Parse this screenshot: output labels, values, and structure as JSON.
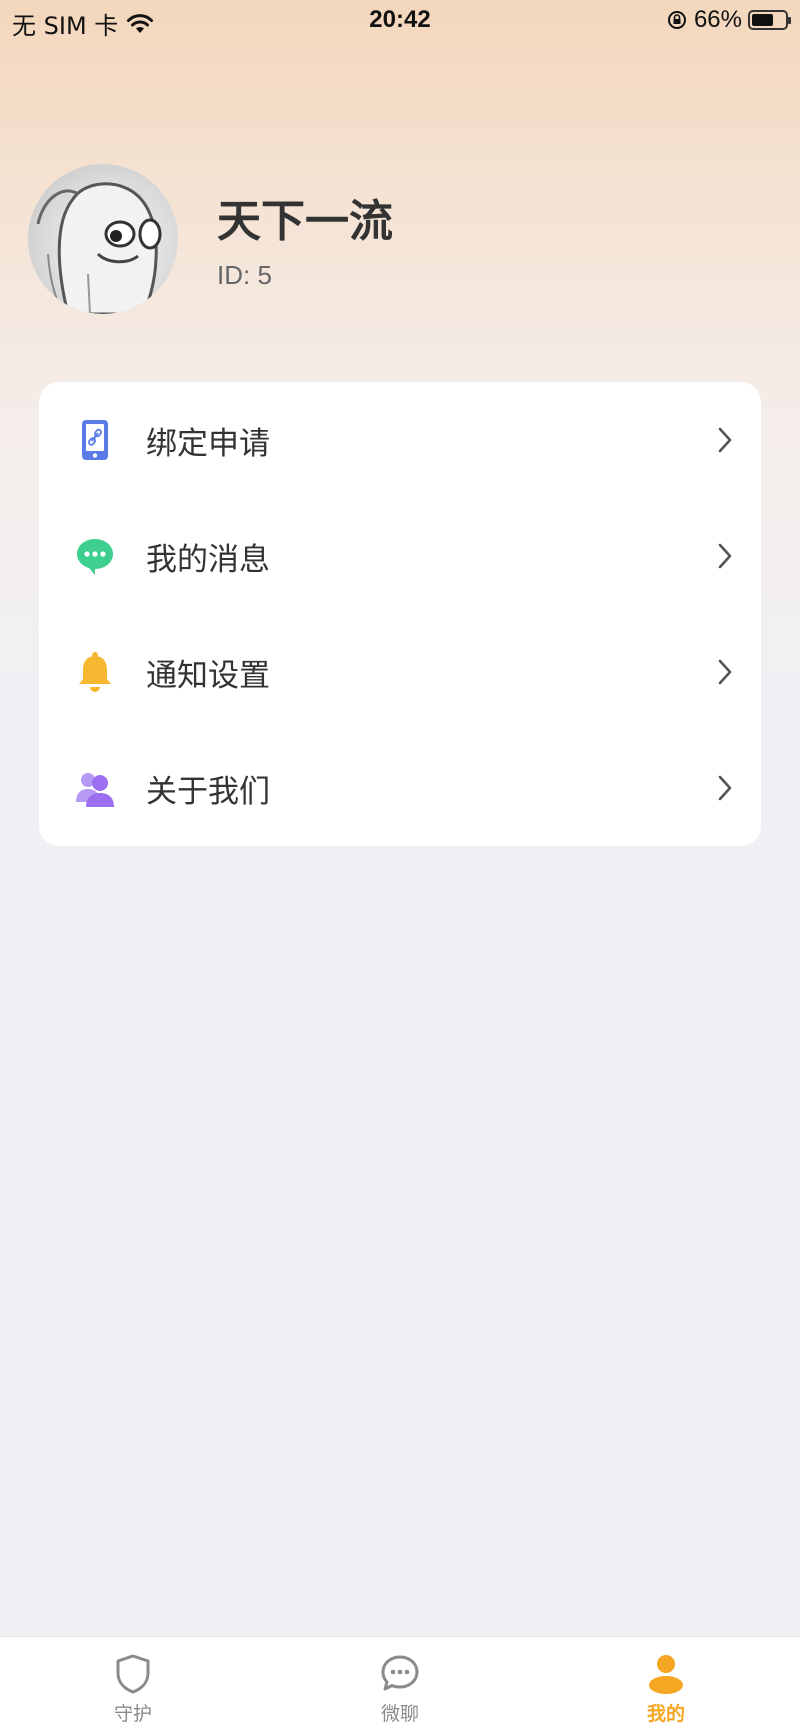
{
  "status_bar": {
    "carrier": "无 SIM 卡",
    "time": "20:42",
    "battery_text": "66%",
    "battery_level": 0.66,
    "icons": [
      "wifi-icon",
      "rotation-lock-icon",
      "battery-icon"
    ]
  },
  "profile": {
    "name": "天下一流",
    "id_text": "ID: 5"
  },
  "menu": {
    "items": [
      {
        "label": "绑定申请",
        "icon": "phone-link-icon",
        "color": "#5b7be9"
      },
      {
        "label": "我的消息",
        "icon": "chat-bubble-icon",
        "color": "#3ecf8e"
      },
      {
        "label": "通知设置",
        "icon": "bell-icon",
        "color": "#f7b731"
      },
      {
        "label": "关于我们",
        "icon": "users-icon",
        "color": "#9b6ff0"
      }
    ]
  },
  "tab_bar": {
    "tabs": [
      {
        "label": "守护",
        "icon": "shield-icon",
        "active": false
      },
      {
        "label": "微聊",
        "icon": "chat-icon",
        "active": false
      },
      {
        "label": "我的",
        "icon": "person-icon",
        "active": true
      }
    ],
    "active_color": "#f5a623",
    "inactive_color": "#8a8a8a"
  }
}
